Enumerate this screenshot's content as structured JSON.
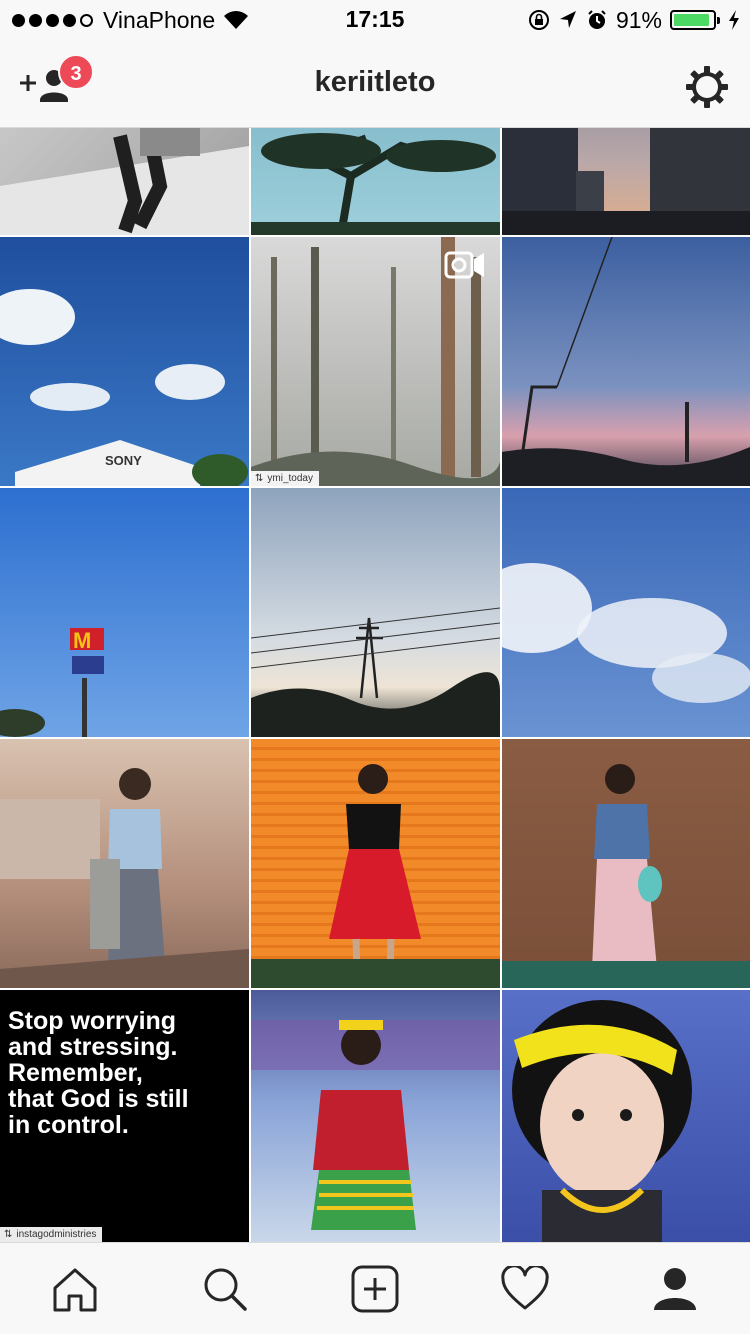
{
  "status_bar": {
    "carrier": "VinaPhone",
    "time": "17:15",
    "battery_percent": "91%",
    "battery_level": 0.91,
    "icons": [
      "signal-icon",
      "wifi-icon",
      "orientation-lock-icon",
      "location-arrow-icon",
      "alarm-icon",
      "battery-icon",
      "charging-icon"
    ]
  },
  "header": {
    "title": "keriitleto",
    "notification_count": "3",
    "left_icon": "add-user-icon",
    "right_icon": "settings-gear-icon"
  },
  "posts": {
    "video_icon": "video-camera-icon",
    "items": [
      {
        "subject": "person-sitting-on-ledge"
      },
      {
        "subject": "tree-silhouette-sky"
      },
      {
        "subject": "city-buildings-sunset"
      },
      {
        "subject": "sony-building-blue-sky"
      },
      {
        "subject": "misty-forest-video",
        "caption": "ymi_today",
        "is_video": true
      },
      {
        "subject": "evening-sky-street-lamp"
      },
      {
        "subject": "mcdonalds-sign-blue-sky"
      },
      {
        "subject": "power-tower-cloudy-sky"
      },
      {
        "subject": "clouds-blue-sky"
      },
      {
        "subject": "woman-sitting-plaza"
      },
      {
        "subject": "woman-orange-shutter"
      },
      {
        "subject": "woman-brown-wall"
      },
      {
        "subject": "quote-image",
        "caption": "instagodministries",
        "quote": "Stop worrying\nand stressing.\nRemember,\nthat God is still\nin control."
      },
      {
        "subject": "woman-traditional-costume"
      },
      {
        "subject": "girl-yellow-headband"
      }
    ]
  },
  "tab_bar": {
    "tabs": [
      {
        "icon": "home-icon"
      },
      {
        "icon": "search-icon"
      },
      {
        "icon": "add-post-icon"
      },
      {
        "icon": "activity-heart-icon"
      },
      {
        "icon": "profile-icon",
        "active": true
      }
    ]
  },
  "colors": {
    "badge": "#ed4956",
    "battery_fill": "#4cd964",
    "bar_background": "#f8f8f8"
  }
}
